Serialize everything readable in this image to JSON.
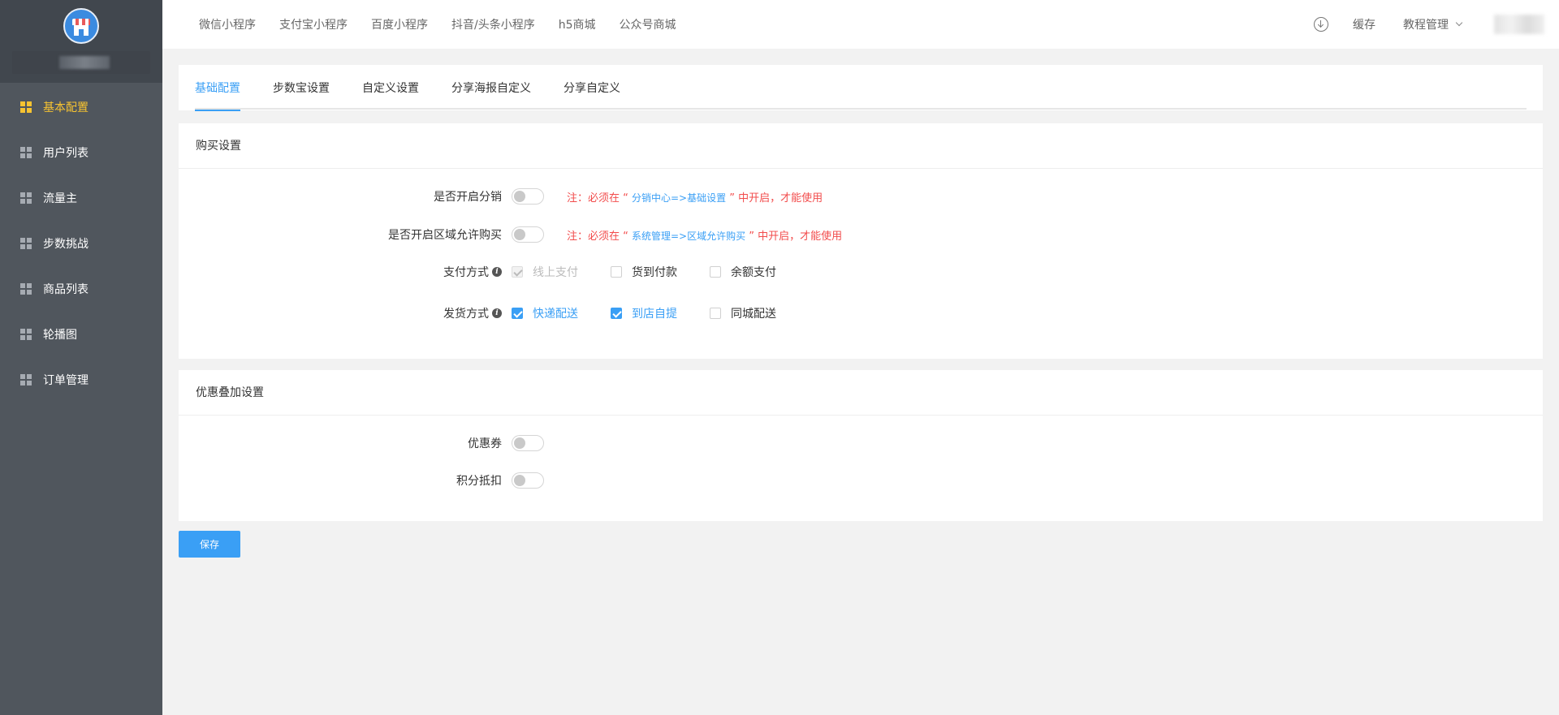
{
  "sidebar": {
    "items": [
      {
        "label": "基本配置",
        "active": true
      },
      {
        "label": "用户列表"
      },
      {
        "label": "流量主"
      },
      {
        "label": "步数挑战"
      },
      {
        "label": "商品列表"
      },
      {
        "label": "轮播图"
      },
      {
        "label": "订单管理"
      }
    ]
  },
  "header": {
    "nav": [
      "微信小程序",
      "支付宝小程序",
      "百度小程序",
      "抖音/头条小程序",
      "h5商城",
      "公众号商城"
    ],
    "cache_label": "缓存",
    "tutorial_label": "教程管理"
  },
  "tabs": [
    "基础配置",
    "步数宝设置",
    "自定义设置",
    "分享海报自定义",
    "分享自定义"
  ],
  "purchase": {
    "title": "购买设置",
    "distribution": {
      "label": "是否开启分销",
      "enabled": false,
      "note_prefix": "注：必须在 “ ",
      "note_link": "分销中心=>基础设置",
      "note_suffix": " ” 中开启，才能使用"
    },
    "region": {
      "label": "是否开启区域允许购买",
      "enabled": false,
      "note_prefix": "注：必须在 “ ",
      "note_link": "系统管理=>区域允许购买",
      "note_suffix": " ” 中开启，才能使用"
    },
    "payment": {
      "label": "支付方式",
      "options": [
        {
          "label": "线上支付",
          "checked": true,
          "disabled": true
        },
        {
          "label": "货到付款",
          "checked": false
        },
        {
          "label": "余额支付",
          "checked": false
        }
      ]
    },
    "shipping": {
      "label": "发货方式",
      "options": [
        {
          "label": "快递配送",
          "checked": true
        },
        {
          "label": "到店自提",
          "checked": true
        },
        {
          "label": "同城配送",
          "checked": false
        }
      ]
    }
  },
  "discount": {
    "title": "优惠叠加设置",
    "coupon": {
      "label": "优惠券",
      "enabled": false
    },
    "points": {
      "label": "积分抵扣",
      "enabled": false
    }
  },
  "save_label": "保存",
  "colors": {
    "accent": "#3a9ff5",
    "active_menu": "#f7c331",
    "warning": "#f24c4c",
    "sidebar": "#50565d"
  }
}
